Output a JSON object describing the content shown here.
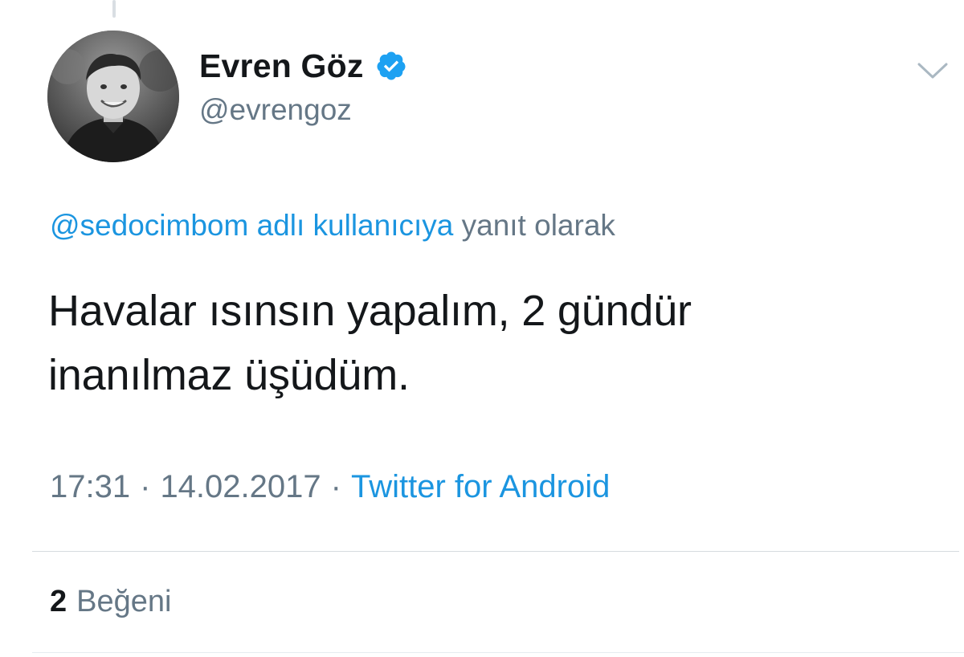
{
  "tweet": {
    "author": {
      "display_name": "Evren Göz",
      "handle": "@evrengoz",
      "verified": true,
      "avatar_icon": "profile-photo"
    },
    "reply_context": {
      "link_text": "@sedocimbom adlı kullanıcıya",
      "suffix": " yanıt olarak"
    },
    "text": "Havalar ısınsın yapalım, 2 gündür\ninanılmaz üşüdüm.",
    "time": "17:31",
    "date": "14.02.2017",
    "separator": "·",
    "source": "Twitter for Android",
    "likes": {
      "count": "2",
      "label": "Beğeni"
    }
  },
  "icons": {
    "verified": "verified-badge-icon",
    "menu": "chevron-down-icon"
  },
  "colors": {
    "link": "#1b95e0",
    "muted": "#657786",
    "text": "#14171a",
    "divider": "#d6dbdf"
  }
}
